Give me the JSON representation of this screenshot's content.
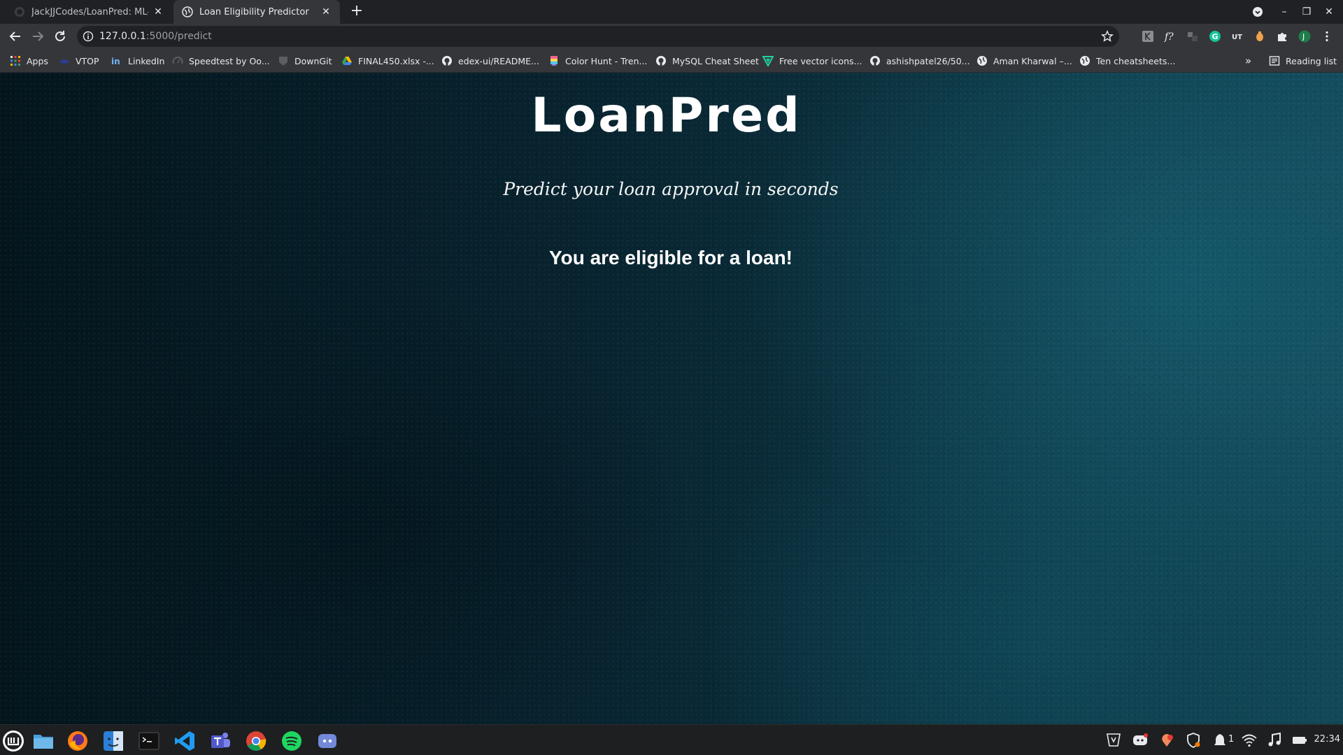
{
  "browser": {
    "tabs": [
      {
        "title": "JackJJCodes/LoanPred: ML-b",
        "active": false
      },
      {
        "title": "Loan Eligibility Predictor",
        "active": true
      }
    ],
    "url_host": "127.0.0.1",
    "url_path": ":5000/predict",
    "bookmarks": [
      {
        "label": "Apps",
        "icon": "apps-grid-icon"
      },
      {
        "label": "VTOP",
        "icon": "vtop-icon"
      },
      {
        "label": "LinkedIn",
        "icon": "linkedin-icon"
      },
      {
        "label": "Speedtest by Oo...",
        "icon": "speedtest-icon"
      },
      {
        "label": "DownGit",
        "icon": "downgit-icon"
      },
      {
        "label": "FINAL450.xlsx -...",
        "icon": "google-drive-icon"
      },
      {
        "label": "edex-ui/README...",
        "icon": "github-icon"
      },
      {
        "label": "Color Hunt - Tren...",
        "icon": "colorhunt-icon"
      },
      {
        "label": "MySQL Cheat Sheet",
        "icon": "github-icon"
      },
      {
        "label": "Free vector icons...",
        "icon": "vector-icon"
      },
      {
        "label": "ashishpatel26/50...",
        "icon": "github-icon"
      },
      {
        "label": "Aman Kharwal –...",
        "icon": "globe-icon"
      },
      {
        "label": "Ten cheatsheets...",
        "icon": "globe-icon"
      }
    ],
    "reading_list": "Reading list",
    "overflow": "»"
  },
  "page": {
    "brand": "LoanPred",
    "tagline": "Predict your loan approval in seconds",
    "result": "You are eligible for a loan!"
  },
  "taskbar": {
    "apps": [
      "mint-menu-icon",
      "files-icon",
      "firefox-icon",
      "finder-icon",
      "terminal-icon",
      "vscode-icon",
      "teams-icon",
      "chrome-icon",
      "spotify-icon",
      "discord-icon"
    ],
    "tray_count": "1",
    "clock": "22:34"
  },
  "colors": {
    "tab_strip": "#202124",
    "toolbar": "#35363a",
    "page_bg_dark": "#04151c",
    "page_bg_light": "#124858",
    "taskbar": "#1e1f21"
  }
}
